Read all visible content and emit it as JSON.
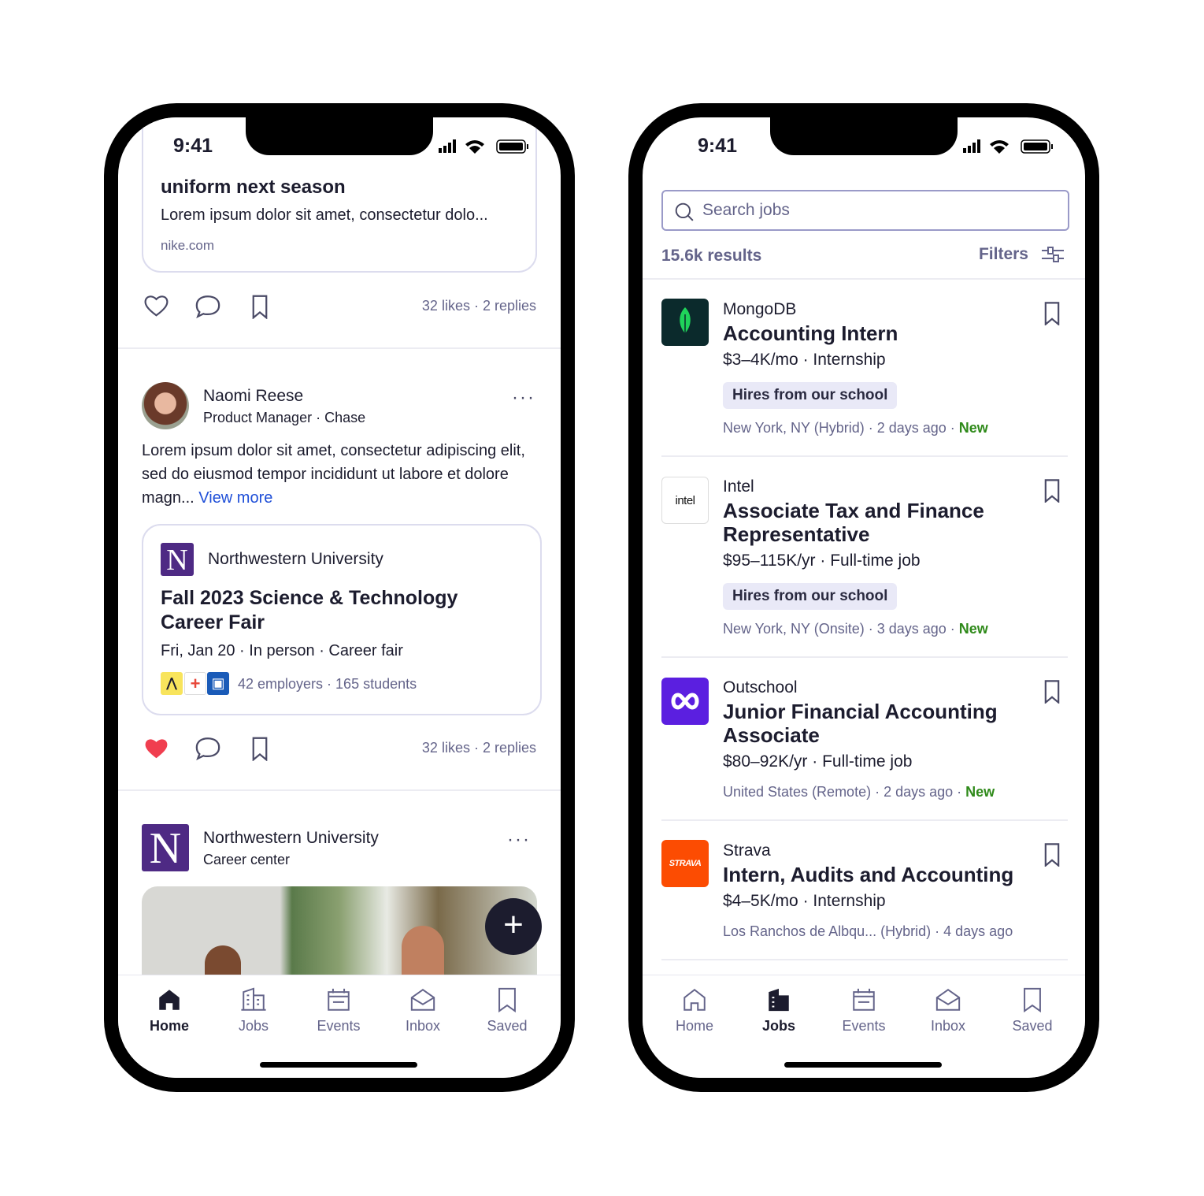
{
  "status": {
    "time": "9:41"
  },
  "feed": {
    "top_card": {
      "title": "uniform next season",
      "text": "Lorem ipsum dolor sit amet, consectetur dolo...",
      "domain": "nike.com",
      "stats": "32 likes · 2 replies"
    },
    "post": {
      "author": "Naomi Reese",
      "subtitle": "Product Manager · Chase",
      "body": "Lorem ipsum dolor sit amet, consectetur adipiscing elit, sed do eiusmod tempor incididunt ut labore et dolore magn...",
      "view_more": "View more",
      "event": {
        "org": "Northwestern University",
        "title": "Fall 2023 Science & Technology Career Fair",
        "details": "Fri, Jan 20 · In person · Career fair",
        "counts": "42 employers · 165 students"
      },
      "stats": "32 likes · 2 replies"
    },
    "post2": {
      "author": "Northwestern University",
      "subtitle": "Career center"
    },
    "nav": [
      {
        "label": "Home"
      },
      {
        "label": "Jobs"
      },
      {
        "label": "Events"
      },
      {
        "label": "Inbox"
      },
      {
        "label": "Saved"
      }
    ],
    "logo_letter": "N"
  },
  "jobs": {
    "search_placeholder": "Search jobs",
    "results": "15.6k results",
    "filters": "Filters",
    "list": [
      {
        "company": "MongoDB",
        "title": "Accounting Intern",
        "pay": "$3–4K/mo · Internship",
        "tag": "Hires from our school",
        "meta": "New York, NY (Hybrid) · 2 days ago · ",
        "new": "New"
      },
      {
        "company": "Intel",
        "title": "Associate Tax and Finance Representative",
        "pay": "$95–115K/yr · Full-time job",
        "tag": "Hires from our school",
        "meta": "New York, NY (Onsite) · 3 days ago · ",
        "new": "New",
        "logo_text": "intel"
      },
      {
        "company": "Outschool",
        "title": "Junior Financial Accounting Associate",
        "pay": "$80–92K/yr · Full-time job",
        "meta": "United States (Remote) · 2 days ago · ",
        "new": "New"
      },
      {
        "company": "Strava",
        "title": "Intern, Audits and Accounting",
        "pay": "$4–5K/mo · Internship",
        "meta": "Los Ranchos de Albqu... (Hybrid) · 4 days ago",
        "logo_text": "STRAVA"
      }
    ],
    "nav": [
      {
        "label": "Home"
      },
      {
        "label": "Jobs"
      },
      {
        "label": "Events"
      },
      {
        "label": "Inbox"
      },
      {
        "label": "Saved"
      }
    ]
  },
  "colors": {
    "link": "#1f4fd8",
    "new": "#2f8a1a",
    "northwestern": "#4e2a84",
    "heart": "#f03e4f"
  }
}
